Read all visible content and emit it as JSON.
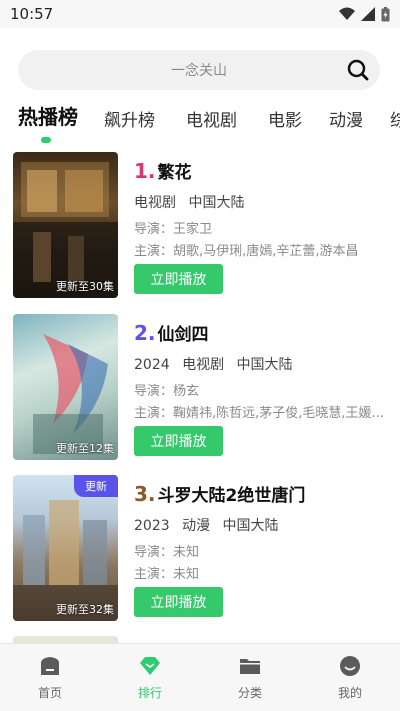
{
  "status_bar": {
    "time": "10:57"
  },
  "search": {
    "placeholder": "一念关山"
  },
  "tabs": [
    {
      "label": "热播榜",
      "active": true
    },
    {
      "label": "飙升榜"
    },
    {
      "label": "电视剧"
    },
    {
      "label": "电影"
    },
    {
      "label": "动漫"
    },
    {
      "label": "综"
    }
  ],
  "items": [
    {
      "rank": "1.",
      "rank_color": "#e0336c",
      "title": "繁花",
      "year": "",
      "category": "电视剧",
      "region": "中国大陆",
      "director": "导演：王家卫",
      "cast": "主演：胡歌,马伊琍,唐嫣,辛芷蕾,游本昌",
      "play_label": "立即播放",
      "poster_caption": "更新至30集",
      "poster_badge": ""
    },
    {
      "rank": "2.",
      "rank_color": "#5b53e9",
      "title": "仙剑四",
      "year": "2024",
      "category": "电视剧",
      "region": "中国大陆",
      "director": "导演：杨玄",
      "cast": "主演：鞠婧祎,陈哲远,茅子俊,毛晓慧,王媛...",
      "play_label": "立即播放",
      "poster_caption": "更新至12集",
      "poster_badge": ""
    },
    {
      "rank": "3.",
      "rank_color": "#8b5a2b",
      "title": "斗罗大陆2绝世唐门",
      "year": "2023",
      "category": "动漫",
      "region": "中国大陆",
      "director": "导演：未知",
      "cast": "主演：未知",
      "play_label": "立即播放",
      "poster_caption": "更新至32集",
      "poster_badge": "更新"
    }
  ],
  "bottom_nav": [
    {
      "label": "首页",
      "icon": "home-icon"
    },
    {
      "label": "排行",
      "icon": "rank-icon",
      "active": true
    },
    {
      "label": "分类",
      "icon": "folder-icon"
    },
    {
      "label": "我的",
      "icon": "profile-icon"
    }
  ],
  "colors": {
    "accent": "#2ecc71",
    "button": "#35c96b",
    "badge": "#5b53e9"
  }
}
